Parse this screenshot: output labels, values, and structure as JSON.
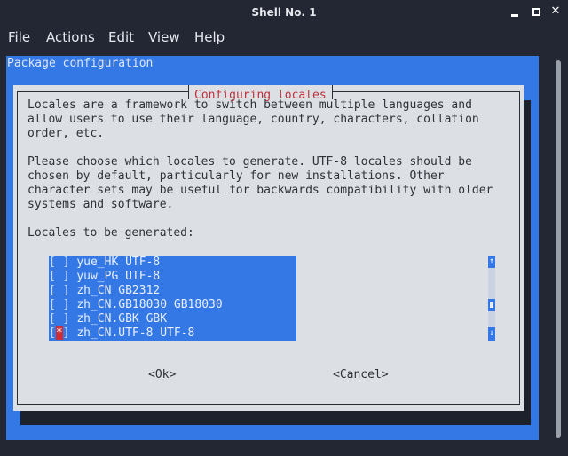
{
  "window": {
    "title": "Shell No. 1",
    "controls": {
      "minimize": "minimize",
      "maximize": "maximize",
      "close": "✕"
    }
  },
  "menubar": [
    "File",
    "Actions",
    "Edit",
    "View",
    "Help"
  ],
  "terminal": {
    "header": "Package configuration",
    "dialog": {
      "title": "Configuring locales",
      "paragraph1": [
        "Locales are a framework to switch between multiple languages and",
        "allow users to use their language, country, characters, collation",
        "order, etc."
      ],
      "paragraph2": [
        "Please choose which locales to generate. UTF-8 locales should be",
        "chosen by default, particularly for new installations. Other",
        "character sets may be useful for backwards compatibility with older",
        "systems and software."
      ],
      "list_label": "Locales to be generated:",
      "locales": [
        {
          "label": "yue_HK UTF-8",
          "checked": false
        },
        {
          "label": "yuw_PG UTF-8",
          "checked": false
        },
        {
          "label": "zh_CN GB2312",
          "checked": false
        },
        {
          "label": "zh_CN.GB18030 GB18030",
          "checked": false
        },
        {
          "label": "zh_CN.GBK GBK",
          "checked": false
        },
        {
          "label": "zh_CN.UTF-8 UTF-8",
          "checked": true
        }
      ],
      "scroll": {
        "up": "↑",
        "down": "↓"
      },
      "ok_label": "<Ok>",
      "cancel_label": "<Cancel>"
    }
  },
  "colors": {
    "terminal_bg": "#222733",
    "dialog_bg": "#dcdfe4",
    "backdrop_blue": "#3478e6",
    "title_red": "#c0303a",
    "checked_mark": "#d12b34"
  }
}
